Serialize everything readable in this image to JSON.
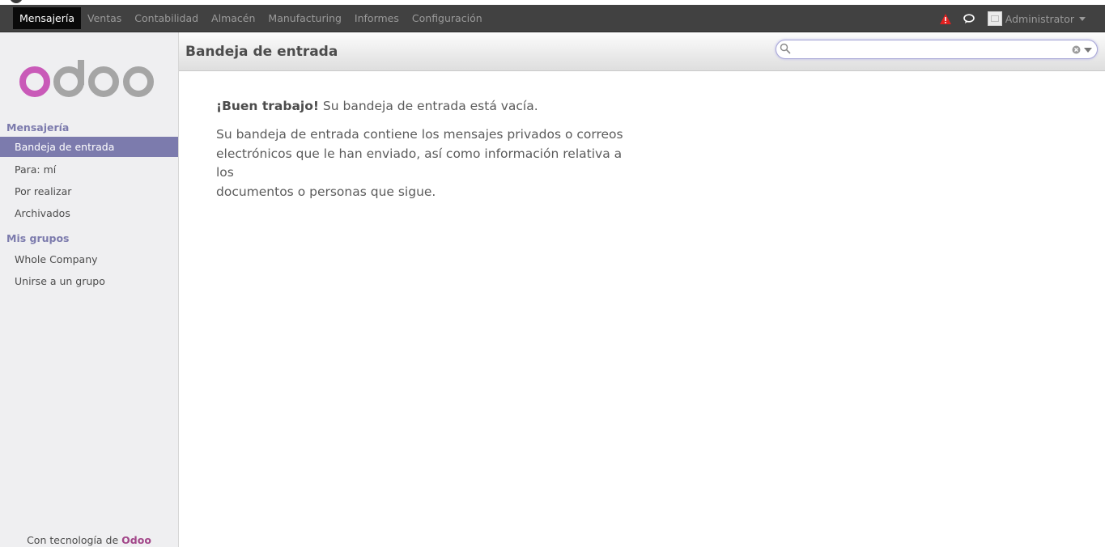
{
  "navbar": {
    "menu": [
      {
        "label": "Mensajería",
        "active": true
      },
      {
        "label": "Ventas",
        "active": false
      },
      {
        "label": "Contabilidad",
        "active": false
      },
      {
        "label": "Almacén",
        "active": false
      },
      {
        "label": "Manufacturing",
        "active": false
      },
      {
        "label": "Informes",
        "active": false
      },
      {
        "label": "Configuración",
        "active": false
      }
    ],
    "user": "Administrator",
    "icons": [
      "warning-icon",
      "chat-icon",
      "avatar"
    ],
    "colors": {
      "background": "#414141",
      "active": "#0a0a0a",
      "warning": "#e02020"
    }
  },
  "sidebar": {
    "logo_text": "odoo",
    "sections": [
      {
        "title": "Mensajería",
        "items": [
          {
            "label": "Bandeja de entrada",
            "active": true
          },
          {
            "label": "Para: mí",
            "active": false
          },
          {
            "label": "Por realizar",
            "active": false
          },
          {
            "label": "Archivados",
            "active": false
          }
        ]
      },
      {
        "title": "Mis grupos",
        "items": [
          {
            "label": "Whole Company",
            "active": false
          },
          {
            "label": "Unirse a un grupo",
            "active": false
          }
        ]
      }
    ],
    "footer_prefix": "Con tecnología de ",
    "footer_brand": "Odoo",
    "colors": {
      "accent": "#7c7bad",
      "brand": "#a24689"
    }
  },
  "header": {
    "title": "Bandeja de entrada",
    "search_value": ""
  },
  "main": {
    "headline_bold": "¡Buen trabajo!",
    "headline_rest": " Su bandeja de entrada está vacía.",
    "body_line_1": "Su bandeja de entrada contiene los mensajes privados o correos",
    "body_line_2": "electrónicos que le han enviado, así como información relativa a los",
    "body_line_3": "documentos o personas que sigue."
  }
}
